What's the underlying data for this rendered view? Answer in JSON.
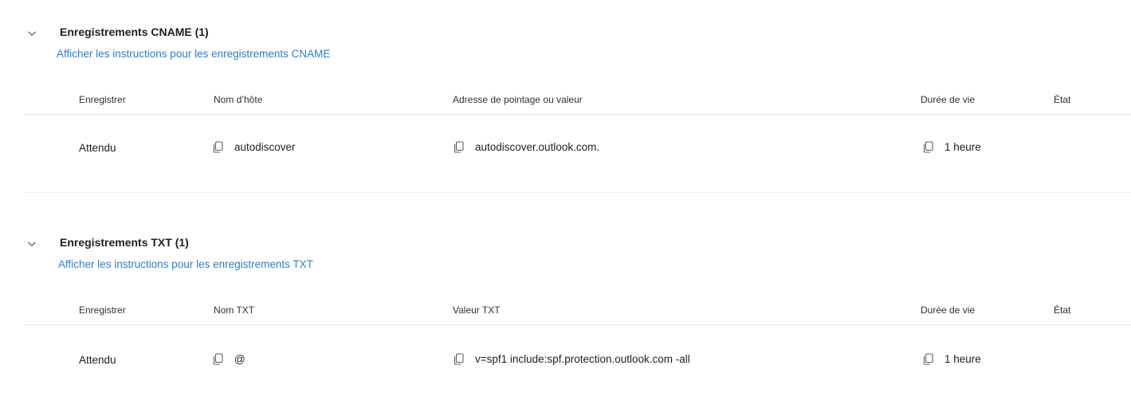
{
  "sections": [
    {
      "title": "Enregistrements CNAME (1)",
      "link": "Afficher les instructions pour les enregistrements CNAME",
      "columns": [
        "Enregistrer",
        "Nom d’hôte",
        "Adresse de pointage ou valeur",
        "Durée de vie",
        "État"
      ],
      "rows": [
        {
          "record": "Attendu",
          "name": "autodiscover",
          "value": "autodiscover.outlook.com.",
          "ttl": "1 heure"
        }
      ]
    },
    {
      "title": "Enregistrements TXT (1)",
      "link": "Afficher les instructions pour les enregistrements TXT",
      "columns": [
        "Enregistrer",
        "Nom TXT",
        "Valeur TXT",
        "Durée de vie",
        "État"
      ],
      "rows": [
        {
          "record": "Attendu",
          "name": "@",
          "value": "v=spf1 include:spf.protection.outlook.com -all",
          "ttl": "1 heure"
        }
      ]
    }
  ],
  "icons": {
    "collapse": "chevron-down-icon",
    "copy": "copy-icon"
  },
  "colors": {
    "link": "#2f7fc6",
    "text": "#201f1e",
    "divider": "#e6e6e6"
  }
}
